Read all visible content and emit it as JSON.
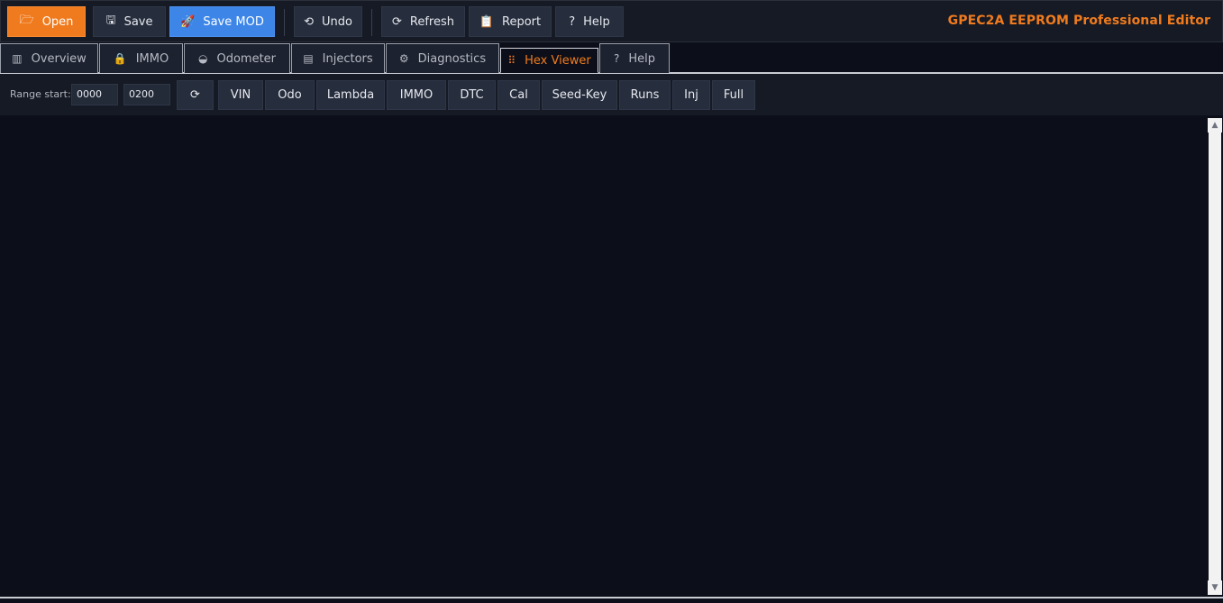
{
  "app": {
    "title": "GPEC2A EEPROM Professional Editor",
    "accent_color": "#f07b1e",
    "primary_color": "#3d86e8"
  },
  "toolbar": {
    "open": {
      "label": "Open",
      "icon": "folder-open-icon",
      "glyph": "🗁"
    },
    "save": {
      "label": "Save",
      "icon": "floppy-disk-icon",
      "glyph": "🖫"
    },
    "save_mod": {
      "label": "Save MOD",
      "icon": "rocket-icon",
      "glyph": "🚀"
    },
    "undo": {
      "label": "Undo",
      "icon": "undo-icon",
      "glyph": "⟲"
    },
    "refresh": {
      "label": "Refresh",
      "icon": "refresh-icon",
      "glyph": "⟳"
    },
    "report": {
      "label": "Report",
      "icon": "clipboard-icon",
      "glyph": "📋"
    },
    "help": {
      "label": "Help",
      "icon": "question-icon",
      "glyph": "?"
    }
  },
  "tabs": [
    {
      "label": "Overview",
      "icon": "bar-chart-icon",
      "glyph": "▥"
    },
    {
      "label": "IMMO",
      "icon": "lock-icon",
      "glyph": "🔒"
    },
    {
      "label": "Odometer",
      "icon": "gauge-icon",
      "glyph": "◒"
    },
    {
      "label": "Injectors",
      "icon": "file-icon",
      "glyph": "▤"
    },
    {
      "label": "Diagnostics",
      "icon": "gears-icon",
      "glyph": "⚙"
    },
    {
      "label": "Hex Viewer",
      "icon": "hex-grid-icon",
      "glyph": "⠿",
      "active": true
    },
    {
      "label": "Help",
      "icon": "question-icon",
      "glyph": "?"
    }
  ],
  "range": {
    "label": "Range start:",
    "start": "0000",
    "length": "0200"
  },
  "presets": {
    "reload_glyph": "⟳",
    "reload_icon": "reload-icon",
    "items": [
      "VIN",
      "Odo",
      "Lambda",
      "IMMO",
      "DTC",
      "Cal",
      "Seed-Key",
      "Runs",
      "Inj",
      "Full"
    ]
  }
}
